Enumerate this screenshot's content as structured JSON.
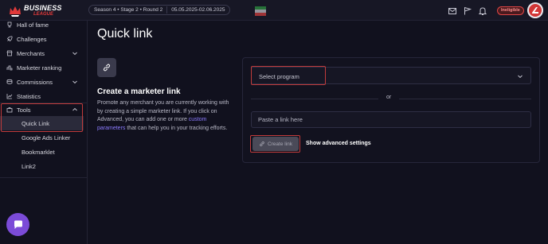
{
  "brand": {
    "line1": "BUSINESS",
    "line2": "LEAGUE"
  },
  "season": {
    "stage": "Season 4 • Stage 2 • Round 2",
    "dates": "05.05.2025-02.06.2025"
  },
  "header": {
    "status_badge": "Ineligible",
    "icons": [
      "mail-icon",
      "flag-icon",
      "bell-icon"
    ]
  },
  "sidebar": {
    "items": [
      {
        "label": "Hall of fame",
        "icon": "trophy-icon"
      },
      {
        "label": "Challenges",
        "icon": "rocket-icon"
      },
      {
        "label": "Merchants",
        "icon": "shop-icon"
      },
      {
        "label": "Marketer ranking",
        "icon": "ranking-icon"
      },
      {
        "label": "Commissions",
        "icon": "coins-icon"
      },
      {
        "label": "Statistics",
        "icon": "chart-icon"
      },
      {
        "label": "Tools",
        "icon": "briefcase-icon"
      }
    ],
    "tools_sub": [
      {
        "label": "Quick Link"
      },
      {
        "label": "Google Ads Linker"
      },
      {
        "label": "Bookmarklet"
      },
      {
        "label": "Link2"
      }
    ]
  },
  "main": {
    "title": "Quick link",
    "section_title": "Create a marketer link",
    "desc_before": "Promote any merchant you are currently working with by creating a simple marketer link. If you click on Advanced, you can add one or more ",
    "desc_link": "custom parameters",
    "desc_after": " that can help you in your tracking efforts.",
    "select_placeholder": "Select program",
    "or_text": "or",
    "input_placeholder": "Paste a link here",
    "create_button": "Create link",
    "advanced_link": "Show advanced settings"
  },
  "colors": {
    "accent_red": "#c13b3b",
    "accent_purple": "#7b4bd8",
    "link_purple": "#8c7cff"
  }
}
